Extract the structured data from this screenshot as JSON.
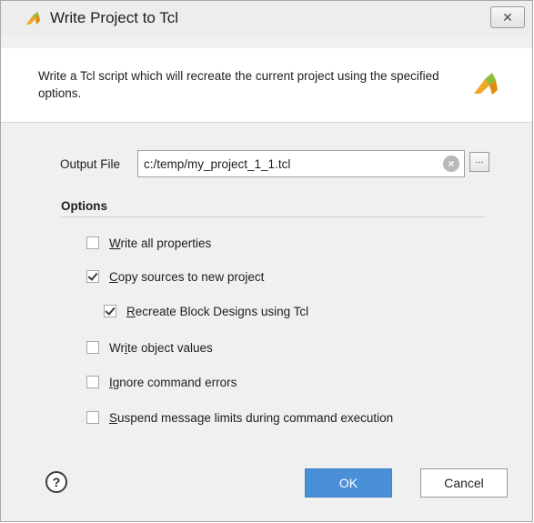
{
  "window": {
    "title": "Write Project to Tcl",
    "close_glyph": "✕"
  },
  "header": {
    "description": "Write a Tcl script which will recreate the current project using the specified options."
  },
  "output_file": {
    "label": "Output File",
    "value": "c:/temp/my_project_1_1.tcl",
    "browse_label": "..."
  },
  "options": {
    "heading": "Options",
    "items": [
      {
        "mnemonic": "W",
        "rest": "rite all properties",
        "checked": false
      },
      {
        "mnemonic": "C",
        "rest": "opy sources to new project",
        "checked": true
      },
      {
        "mnemonic": "R",
        "rest": "ecreate Block Designs using Tcl",
        "checked": true
      },
      {
        "prefix": "Wr",
        "mnemonic": "i",
        "rest": "te object values",
        "checked": false
      },
      {
        "mnemonic": "I",
        "rest": "gnore command errors",
        "checked": false
      },
      {
        "mnemonic": "S",
        "rest": "uspend message limits during command execution",
        "checked": false
      }
    ]
  },
  "footer": {
    "help_glyph": "?",
    "ok_label": "OK",
    "cancel_label": "Cancel"
  },
  "icons": {
    "app": "xilinx-logo-icon",
    "header_logo": "xilinx-logo-icon",
    "clear": "clear-icon",
    "help": "help-icon"
  },
  "colors": {
    "accent": "#4a90d9",
    "logo_primary": "#f5a623",
    "logo_secondary": "#8fbc3a"
  }
}
